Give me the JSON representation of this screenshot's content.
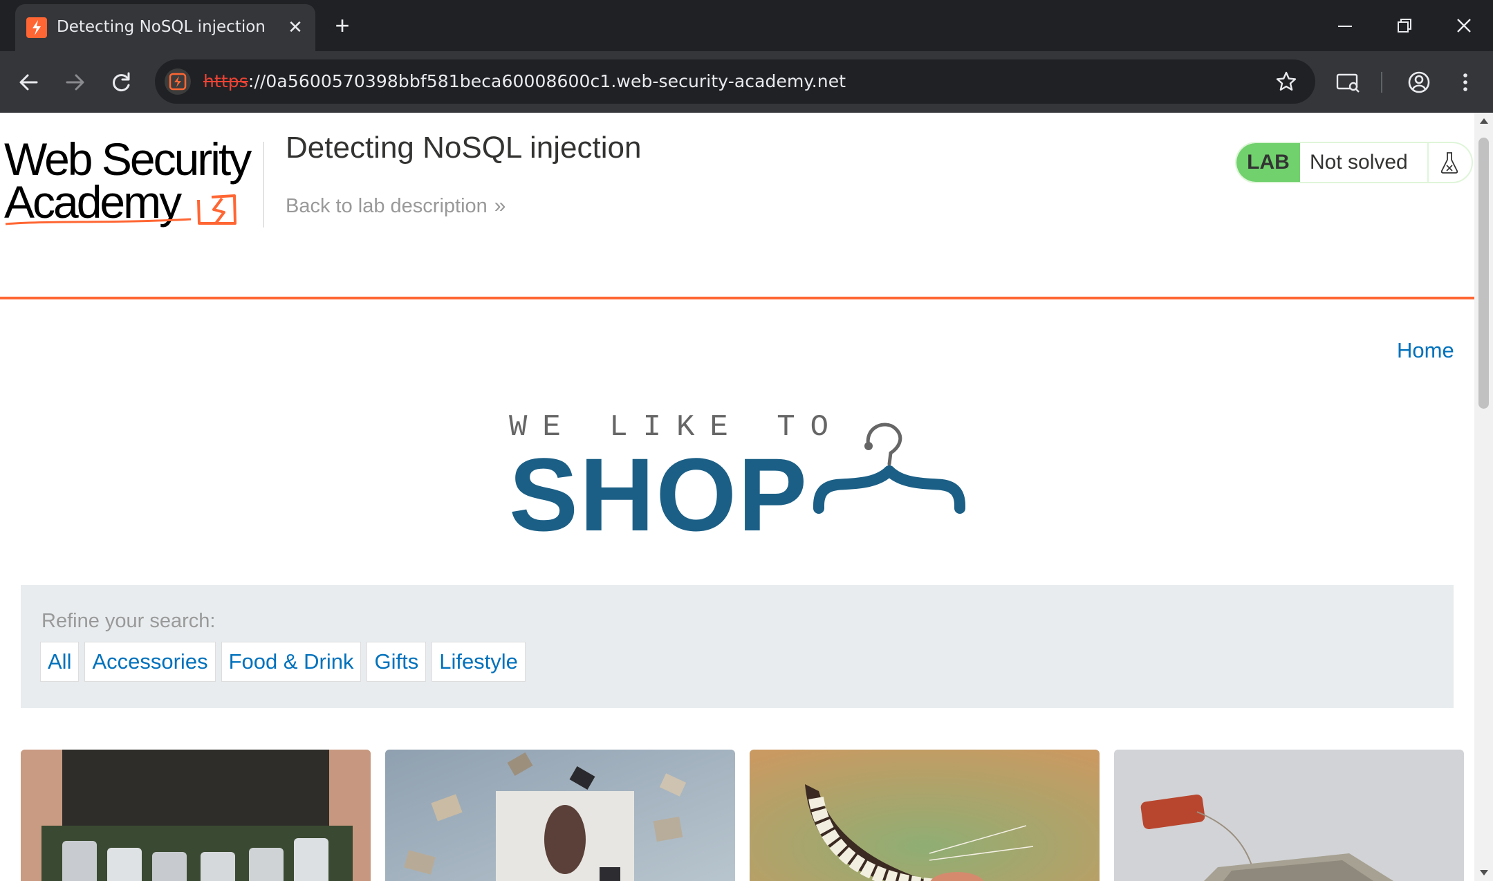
{
  "browser": {
    "tab_title": "Detecting NoSQL injection",
    "tab_close": "✕",
    "new_tab": "+",
    "url_scheme": "https",
    "url_rest": "://0a5600570398bbf581beca60008600c1.web-security-academy.net"
  },
  "academy": {
    "logo_line1": "Web Security",
    "logo_line2": "Academy",
    "lab_title": "Detecting NoSQL injection",
    "back_link": "Back to lab description",
    "back_chevron": "»",
    "lab_badge": "LAB",
    "lab_status": "Not solved",
    "accent_color": "#ff6633",
    "lab_badge_color": "#70d16d"
  },
  "shop": {
    "nav_home": "Home",
    "tagline": "WE LIKE TO",
    "brand": "SHOP",
    "brand_color": "#1b5f86",
    "refine_label": "Refine your search:",
    "filters": [
      "All",
      "Accessories",
      "Food & Drink",
      "Gifts",
      "Lifestyle"
    ],
    "link_color": "#0071bc"
  },
  "icons": {
    "back": "arrow-left-icon",
    "forward": "arrow-right-icon",
    "reload": "reload-icon",
    "bookmark": "star-icon",
    "profile": "account-circle-icon",
    "menu": "kebab-menu-icon",
    "flask": "flask-icon",
    "hanger": "coat-hanger-icon"
  }
}
